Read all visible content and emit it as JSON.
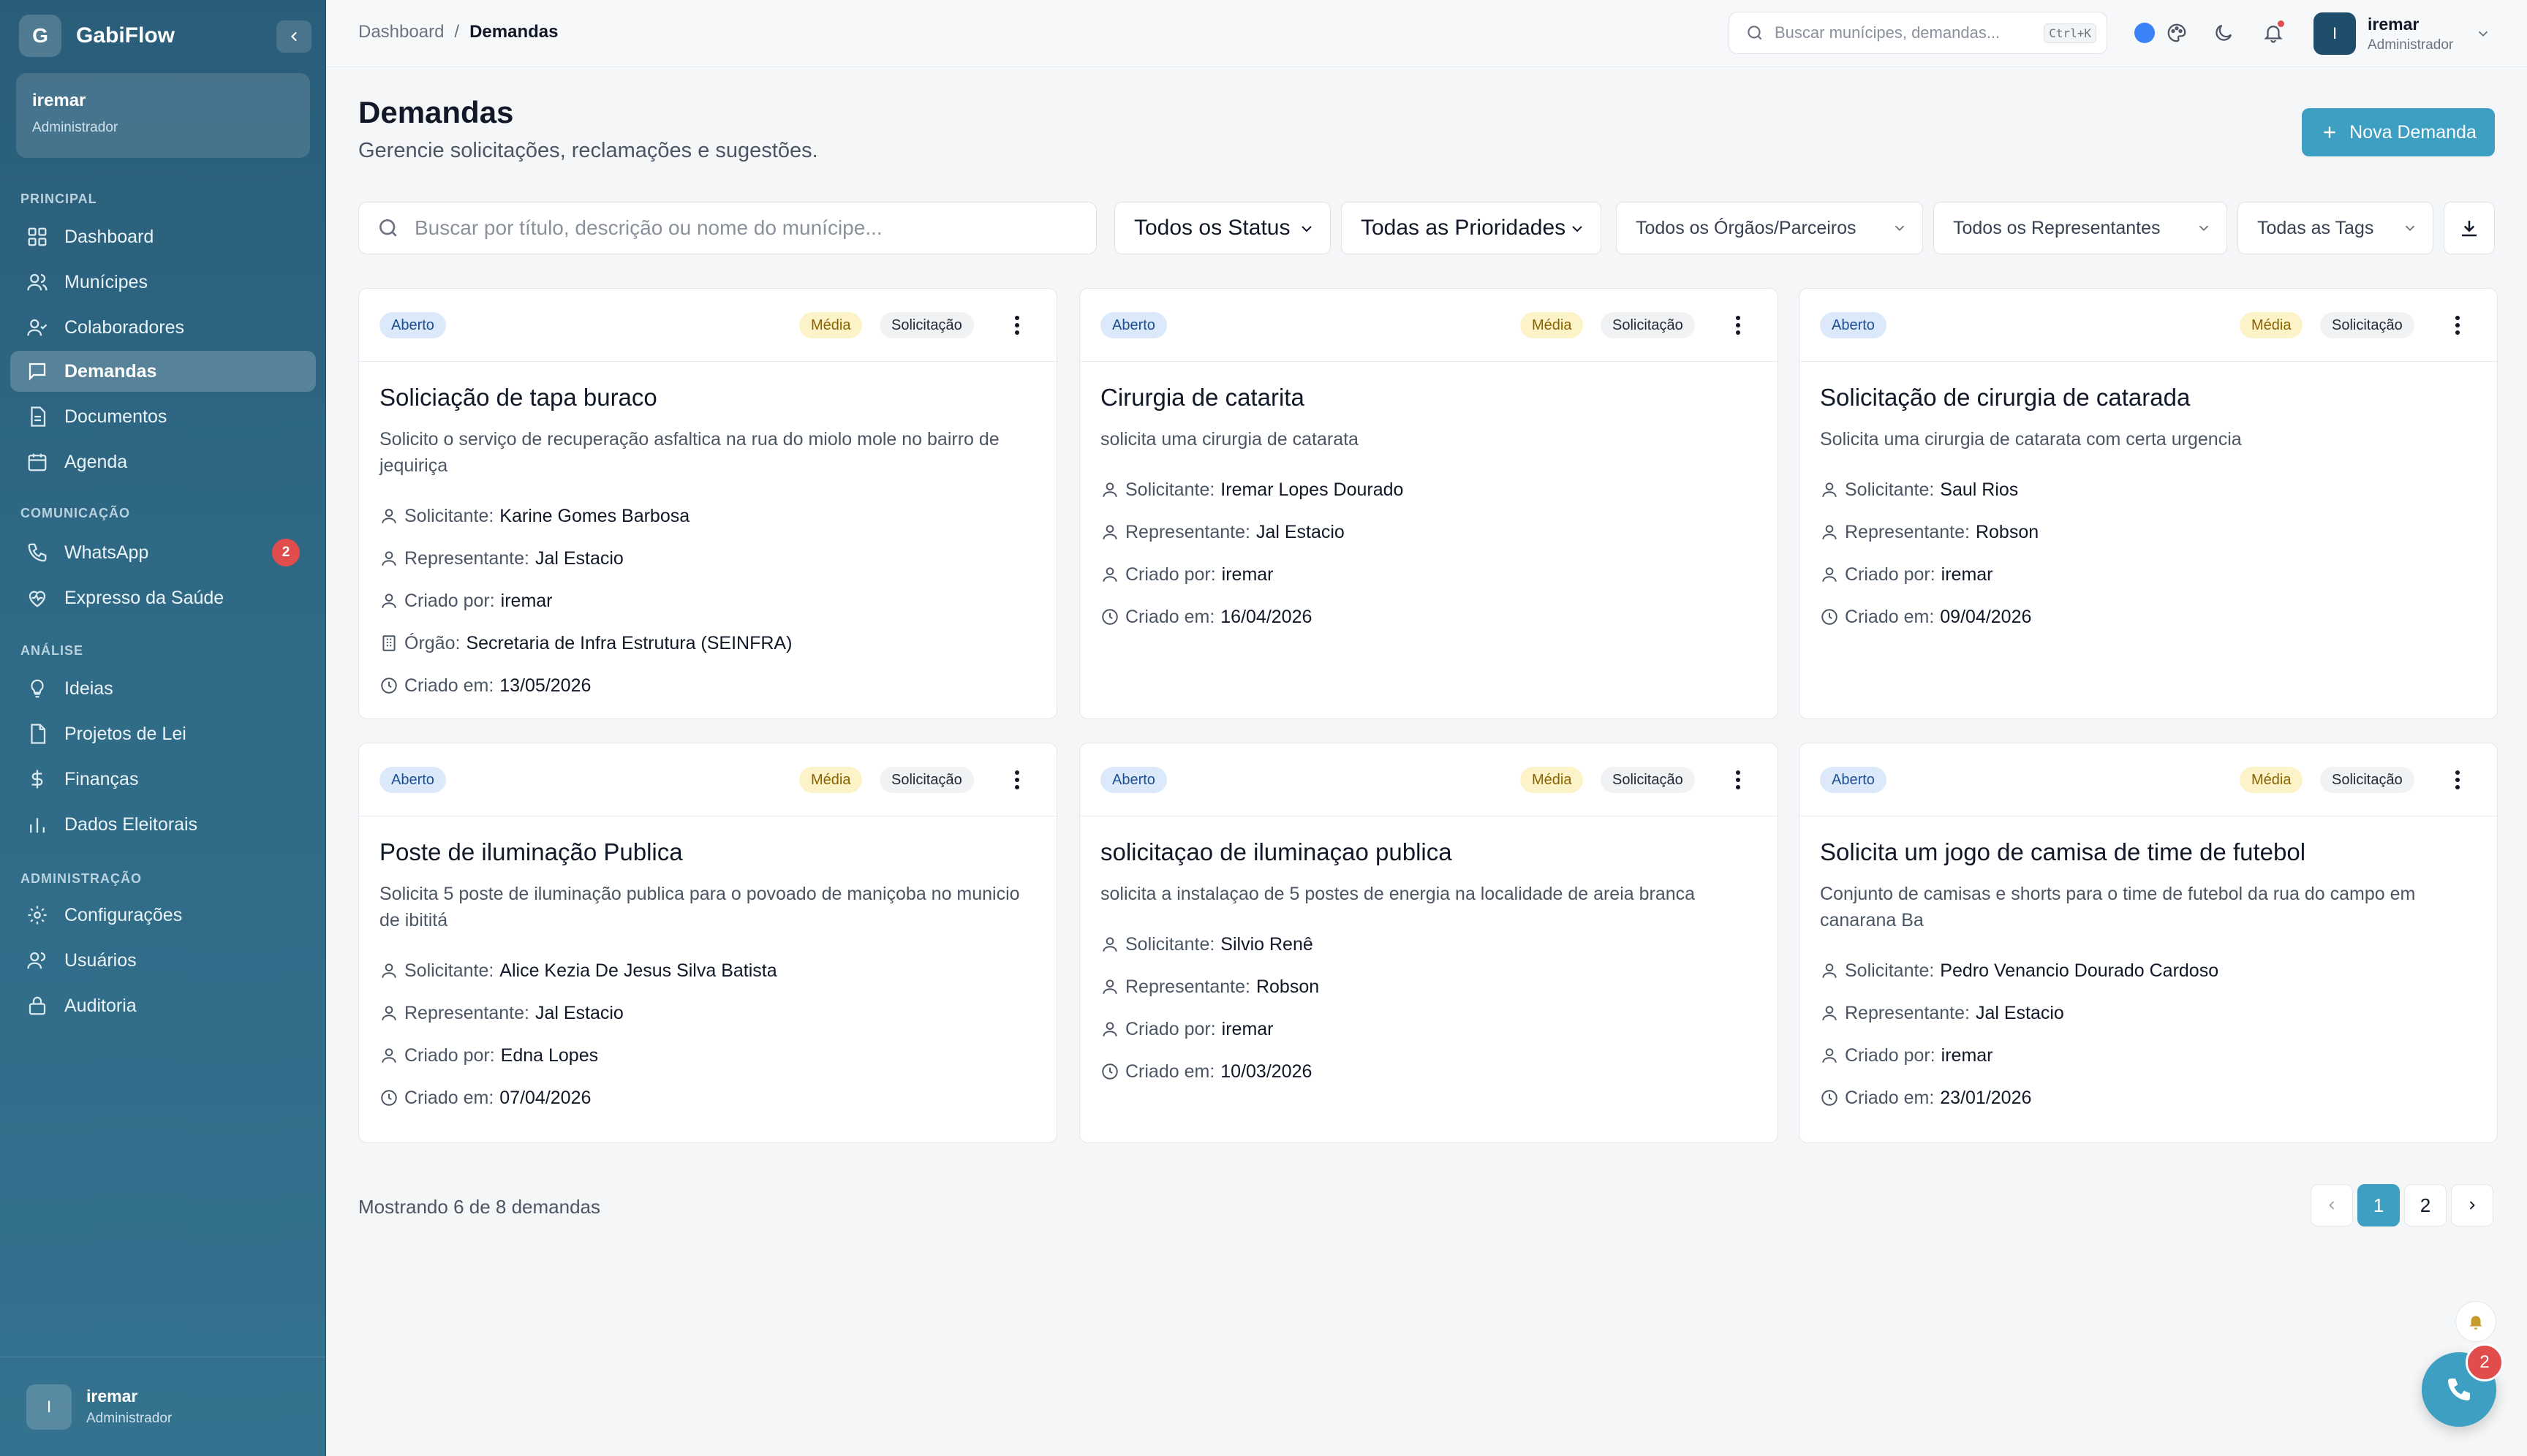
{
  "brand": {
    "initial": "G",
    "name": "GabiFlow"
  },
  "sidebar": {
    "user": {
      "name": "iremar",
      "role": "Administrador"
    },
    "sections": {
      "principal": "PRINCIPAL",
      "comunicacao": "COMUNICAÇÃO",
      "analise": "ANÁLISE",
      "administracao": "ADMINISTRAÇÃO"
    },
    "items": {
      "dashboard": "Dashboard",
      "municipes": "Munícipes",
      "colaboradores": "Colaboradores",
      "demandas": "Demandas",
      "documentos": "Documentos",
      "agenda": "Agenda",
      "whatsapp": "WhatsApp",
      "whatsapp_badge": "2",
      "expresso": "Expresso da Saúde",
      "ideias": "Ideias",
      "projetos": "Projetos de Lei",
      "financas": "Finanças",
      "dados": "Dados Eleitorais",
      "configuracoes": "Configurações",
      "usuarios": "Usuários",
      "auditoria": "Auditoria"
    },
    "footer": {
      "initial": "I",
      "name": "iremar",
      "role": "Administrador"
    }
  },
  "topbar": {
    "breadcrumb": {
      "root": "Dashboard",
      "sep": "/",
      "current": "Demandas"
    },
    "search_placeholder": "Buscar munícipes, demandas...",
    "search_shortcut": "Ctrl+K",
    "user": {
      "initial": "I",
      "name": "iremar",
      "role": "Administrador"
    }
  },
  "page": {
    "title": "Demandas",
    "subtitle": "Gerencie solicitações, reclamações e sugestões.",
    "new_button": "Nova Demanda"
  },
  "filters": {
    "search_placeholder": "Buscar por título, descrição ou nome do munícipe...",
    "status": "Todos os Status",
    "prioridade": "Todas as Prioridades",
    "orgaos": "Todos os Órgãos/Parceiros",
    "representantes": "Todos os Representantes",
    "tags": "Todas as Tags"
  },
  "labels": {
    "solicitante": "Solicitante:",
    "representante": "Representante:",
    "criado_por": "Criado por:",
    "orgao": "Órgão:",
    "criado_em": "Criado em:"
  },
  "cards": [
    {
      "status": "Aberto",
      "prioridade": "Média",
      "tipo": "Solicitação",
      "title": "Soliciação de tapa buraco",
      "desc": "Solicito o serviço de recuperação asfaltica na rua do miolo mole no bairro de jequiriça",
      "solicitante": "Karine Gomes Barbosa",
      "representante": "Jal Estacio",
      "criado_por": "iremar",
      "orgao": "Secretaria de Infra Estrutura (SEINFRA)",
      "criado_em": "13/05/2026"
    },
    {
      "status": "Aberto",
      "prioridade": "Média",
      "tipo": "Solicitação",
      "title": "Cirurgia de catarita",
      "desc": "solicita uma cirurgia de catarata",
      "solicitante": "Iremar Lopes Dourado",
      "representante": "Jal Estacio",
      "criado_por": "iremar",
      "criado_em": "16/04/2026"
    },
    {
      "status": "Aberto",
      "prioridade": "Média",
      "tipo": "Solicitação",
      "title": "Solicitação de cirurgia de catarada",
      "desc": "Solicita uma cirurgia de catarata com certa urgencia",
      "solicitante": "Saul Rios",
      "representante": "Robson",
      "criado_por": "iremar",
      "criado_em": "09/04/2026"
    },
    {
      "status": "Aberto",
      "prioridade": "Média",
      "tipo": "Solicitação",
      "title": "Poste de iluminação Publica",
      "desc": "Solicita 5 poste de iluminação publica para o povoado de maniçoba no municio de ibititá",
      "solicitante": "Alice Kezia De Jesus Silva Batista",
      "representante": "Jal Estacio",
      "criado_por": "Edna Lopes",
      "criado_em": "07/04/2026"
    },
    {
      "status": "Aberto",
      "prioridade": "Média",
      "tipo": "Solicitação",
      "title": "solicitaçao de iluminaçao publica",
      "desc": "solicita a instalaçao de 5 postes de energia na localidade de areia branca",
      "solicitante": "Silvio Renê",
      "representante": "Robson",
      "criado_por": "iremar",
      "criado_em": "10/03/2026"
    },
    {
      "status": "Aberto",
      "prioridade": "Média",
      "tipo": "Solicitação",
      "title": "Solicita um jogo de camisa de time de futebol",
      "desc": "Conjunto de camisas e shorts para o time de futebol da rua do campo em canarana Ba",
      "solicitante": "Pedro Venancio Dourado Cardoso",
      "representante": "Jal Estacio",
      "criado_por": "iremar",
      "criado_em": "23/01/2026"
    }
  ],
  "pagination": {
    "info": "Mostrando 6 de 8 demandas",
    "page1": "1",
    "page2": "2"
  },
  "fab": {
    "badge": "2"
  },
  "colors": {
    "accent": "#3d9fc2",
    "sidebar": "#2f6a86",
    "danger": "#e14c4c"
  }
}
